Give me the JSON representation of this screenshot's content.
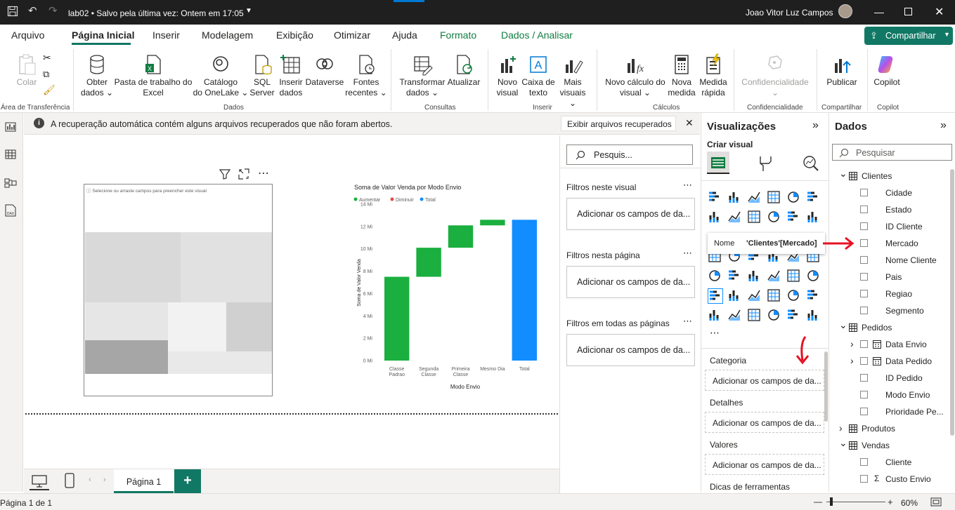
{
  "titlebar": {
    "title": "lab02 • Salvo pela última vez: Ontem em 17:05",
    "user": "Joao Vitor Luz Campos"
  },
  "menu": {
    "items": [
      "Arquivo",
      "Página Inicial",
      "Inserir",
      "Modelagem",
      "Exibição",
      "Otimizar",
      "Ajuda",
      "Formato",
      "Dados / Analisar"
    ],
    "share": "Compartilhar"
  },
  "ribbon": {
    "colar": "Colar",
    "area_transferencia": "Área de Transferência",
    "obter": [
      "Obter",
      "dados"
    ],
    "excel": [
      "Pasta de trabalho do",
      "Excel"
    ],
    "onelake": [
      "Catálogo",
      "do OneLake"
    ],
    "sql": [
      "SQL",
      "Server"
    ],
    "inserir_dados": [
      "Inserir",
      "dados"
    ],
    "dataverse": "Dataverse",
    "fontes": [
      "Fontes",
      "recentes"
    ],
    "grp_dados": "Dados",
    "transformar": [
      "Transformar",
      "dados"
    ],
    "atualizar": "Atualizar",
    "grp_consultas": "Consultas",
    "novo_visual": [
      "Novo",
      "visual"
    ],
    "caixa_texto": [
      "Caixa de",
      "texto"
    ],
    "mais_visuais": [
      "Mais",
      "visuais"
    ],
    "grp_inserir": "Inserir",
    "novo_calculo": [
      "Novo cálculo do",
      "visual"
    ],
    "nova_medida": [
      "Nova",
      "medida"
    ],
    "medida_rapida": [
      "Medida",
      "rápida"
    ],
    "grp_calculos": "Cálculos",
    "confidencialidade": "Confidencialidade",
    "grp_confidencialidade": "Confidencialidade",
    "publicar": "Publicar",
    "grp_compartilhar": "Compartilhar",
    "copilot": "Copilot",
    "grp_copilot": "Copilot"
  },
  "notification": {
    "text": "A recuperação automática contém alguns arquivos recuperados que não foram abertos.",
    "button": "Exibir arquivos recuperados"
  },
  "canvas": {
    "placeholder_hint": "Selecione ou arraste campos para preencher este visual"
  },
  "chart_data": {
    "type": "waterfall",
    "title": "Soma de Valor Venda por Modo Envio",
    "legend": [
      "Aumentar",
      "Diminuir",
      "Total"
    ],
    "colors": {
      "aumentar": "#1aaf3e",
      "diminuir": "#e8484a",
      "total": "#118dff"
    },
    "categories": [
      [
        "Classe",
        "Padrao"
      ],
      [
        "Segunda",
        "Classe"
      ],
      [
        "Primeira",
        "Classe"
      ],
      [
        "Mesmo Dia"
      ],
      [
        "Total"
      ]
    ],
    "values": [
      7.5,
      2.6,
      2.0,
      0.5,
      12.6
    ],
    "kinds": [
      "aumentar",
      "aumentar",
      "aumentar",
      "aumentar",
      "total"
    ],
    "yticks": [
      "0 Mi",
      "2 Mi",
      "4 Mi",
      "6 Mi",
      "8 Mi",
      "10 Mi",
      "12 Mi",
      "14 Mi"
    ],
    "ylim": [
      0,
      14
    ],
    "xlabel": "Modo Envio",
    "ylabel": "Soma de Valor Venda"
  },
  "filters": {
    "search_placeholder": "Pesquis...",
    "visual_title": "Filtros neste visual",
    "page_title": "Filtros nesta página",
    "all_title": "Filtros em todas as páginas",
    "add_fields": "Adicionar os campos de da..."
  },
  "viz": {
    "title": "Visualizações",
    "build": "Criar visual",
    "tooltip_label": "Nome",
    "tooltip_value": "'Clientes'[Mercado]",
    "wells": [
      "Categoria",
      "Detalhes",
      "Valores",
      "Dicas de ferramentas"
    ],
    "add_fields": "Adicionar os campos de da..."
  },
  "dados": {
    "title": "Dados",
    "search_placeholder": "Pesquisar",
    "tables": [
      {
        "name": "Clientes",
        "fields": [
          "Cidade",
          "Estado",
          "ID Cliente",
          "Mercado",
          "Nome Cliente",
          "Pais",
          "Regiao",
          "Segmento"
        ]
      },
      {
        "name": "Pedidos",
        "fields": [
          "Data Envio",
          "Data Pedido",
          "ID Pedido",
          "Modo Envio",
          "Prioridade Pe..."
        ]
      },
      {
        "name": "Produtos",
        "fields": []
      },
      {
        "name": "Vendas",
        "fields": [
          "Cliente",
          "Custo Envio"
        ]
      }
    ]
  },
  "pages": {
    "tab": "Página 1"
  },
  "status": {
    "page": "Página 1 de 1",
    "zoom": "60%"
  }
}
